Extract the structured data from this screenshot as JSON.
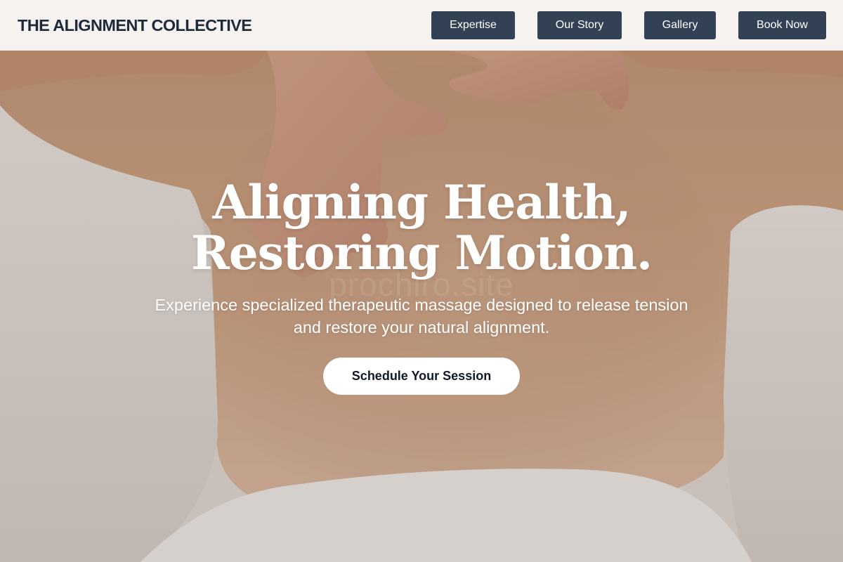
{
  "header": {
    "brand": "THE ALIGNMENT COLLECTIVE",
    "nav": [
      {
        "label": "Expertise"
      },
      {
        "label": "Our Story"
      },
      {
        "label": "Gallery"
      },
      {
        "label": "Book Now"
      }
    ]
  },
  "hero": {
    "title_line1": "Aligning Health,",
    "title_line2": "Restoring Motion.",
    "watermark": "prochiro.site",
    "subtitle_line1": "Experience specialized therapeutic massage designed to release tension",
    "subtitle_line2": "and restore your natural alignment.",
    "cta": "Schedule Your Session"
  },
  "colors": {
    "nav_button_bg": "#334155",
    "brand_text": "#1f2a3a",
    "cta_bg": "#ffffff",
    "cta_text": "#111827"
  }
}
